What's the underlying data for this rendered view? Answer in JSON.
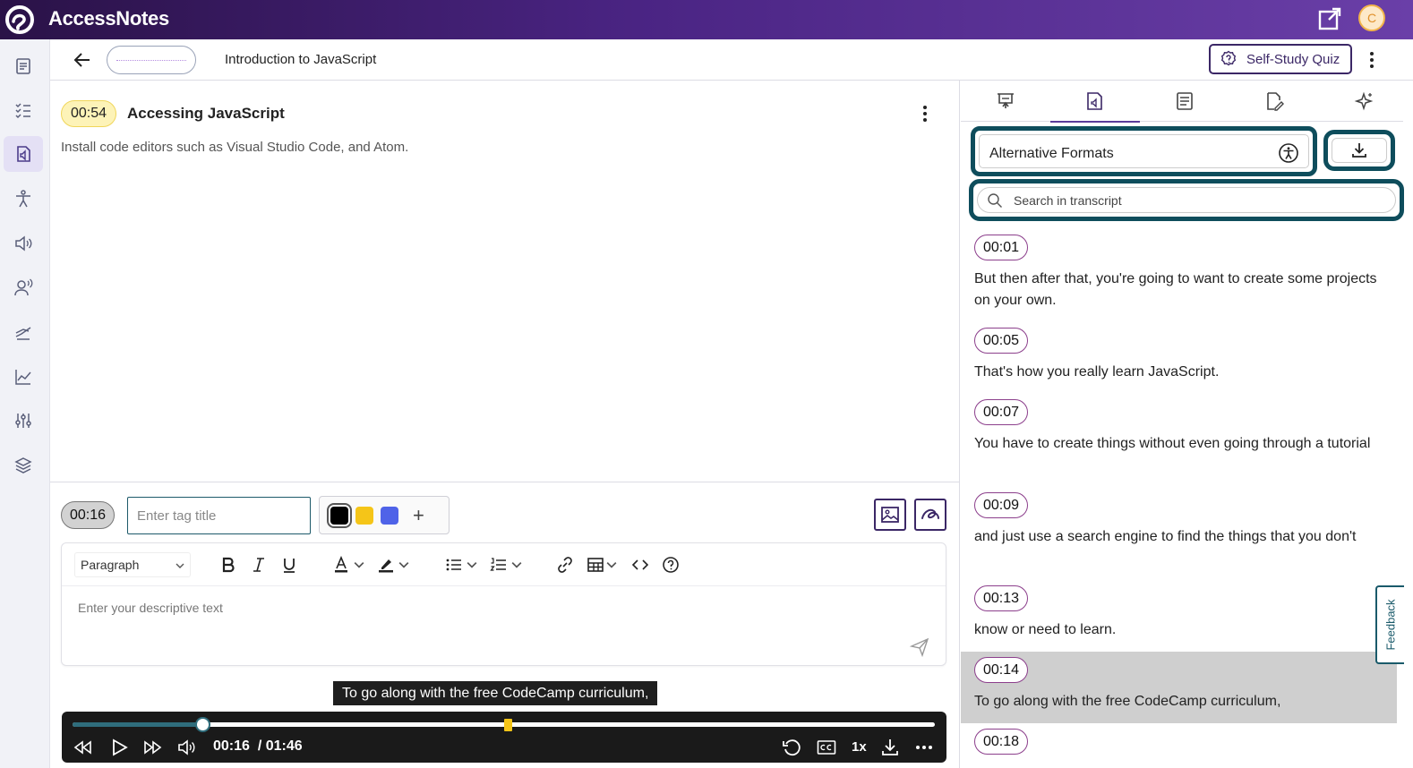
{
  "app": {
    "title": "AccessNotes",
    "avatar_initial": "C"
  },
  "header": {
    "lesson_title": "Introduction to JavaScript",
    "quiz_label": "Self-Study Quiz"
  },
  "rail": {
    "icons": [
      "notes-icon",
      "checklist-icon",
      "audio-notes-icon",
      "accessibility-icon",
      "speaker-icon",
      "voice-icon",
      "study-icon",
      "analytics-icon",
      "settings-sliders-icon",
      "layers-icon"
    ],
    "active_index": 2
  },
  "note": {
    "timestamp": "00:54",
    "title": "Accessing JavaScript",
    "description": "Install code editors such as Visual Studio Code, and Atom."
  },
  "tag": {
    "timestamp": "00:16",
    "placeholder": "Enter tag title",
    "colors": [
      "#000000",
      "#f5c518",
      "#4f63e8"
    ]
  },
  "editor": {
    "block_type": "Paragraph",
    "placeholder": "Enter your descriptive text"
  },
  "player": {
    "caption": "To go along with the free CodeCamp curriculum,",
    "current": "00:16",
    "duration": "/ 01:46",
    "speed": "1x",
    "progress_fraction": 0.151,
    "marker_fraction": 0.505
  },
  "panel": {
    "alt_formats_label": "Alternative Formats",
    "search_placeholder": "Search in transcript",
    "transcript": [
      {
        "time": "00:01",
        "text": "But then after that, you're going to want to create some projects on your own."
      },
      {
        "time": "00:05",
        "text": "That's how you really learn JavaScript."
      },
      {
        "time": "00:07",
        "text": "You have to create things without even going through a tutorial"
      },
      {
        "time": "00:09",
        "text": "and just use a search engine to find the things that you don't"
      },
      {
        "time": "00:13",
        "text": "know or need to learn."
      },
      {
        "time": "00:14",
        "text": "To go along with the free CodeCamp curriculum,"
      },
      {
        "time": "00:18",
        "text": ""
      }
    ],
    "active_index": 5
  },
  "feedback_label": "Feedback",
  "colors": {
    "brand_dark": "#2a1247",
    "brand": "#6a3fa8",
    "accent_teal": "#0e4d5c",
    "quiz_border": "#3b2766"
  }
}
